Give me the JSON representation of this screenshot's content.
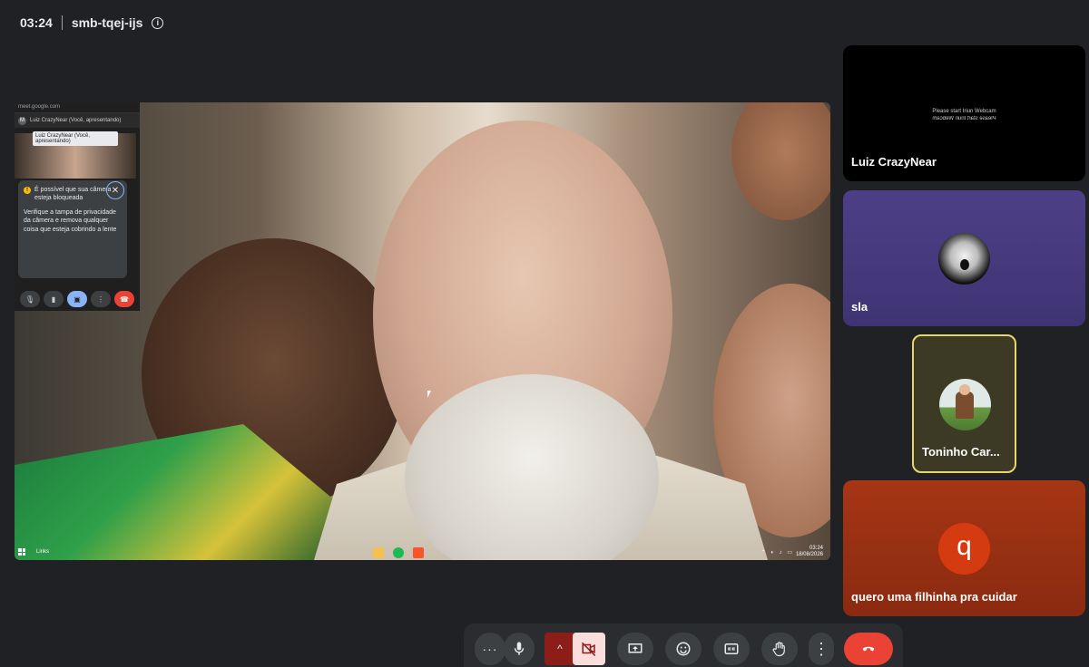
{
  "meeting": {
    "time": "03:24",
    "code": "smb-tqej-ijs",
    "info_icon": "info-icon"
  },
  "presentation": {
    "nested_window": {
      "url": "meet.google.com",
      "presenter_label": "Luiz CrazyNear (Você, apresentando)",
      "tooltip": "Luiz CrazyNear (Você, apresentando)",
      "warning_title": "É possível que sua câmera esteja bloqueada",
      "warning_body": "Verifique a tampa de privacidade da câmera e remova qualquer coisa que esteja cobrindo a lente"
    },
    "taskbar": {
      "search_label": "Links",
      "clock_time": "03:24",
      "clock_date": "18/08/2026"
    }
  },
  "participants": [
    {
      "name": "Luiz CrazyNear",
      "webcam_message": "Please start Iriun Webcam"
    },
    {
      "name": "sla"
    },
    {
      "name": "Toninho Car..."
    },
    {
      "name": "quero uma filhinha pra cuidar",
      "initial": "q"
    }
  ],
  "colors": {
    "background": "#202124",
    "end_call": "#ea4335",
    "active_speaker_border": "#e8d66a",
    "camera_off_bg": "#f9dedc"
  }
}
